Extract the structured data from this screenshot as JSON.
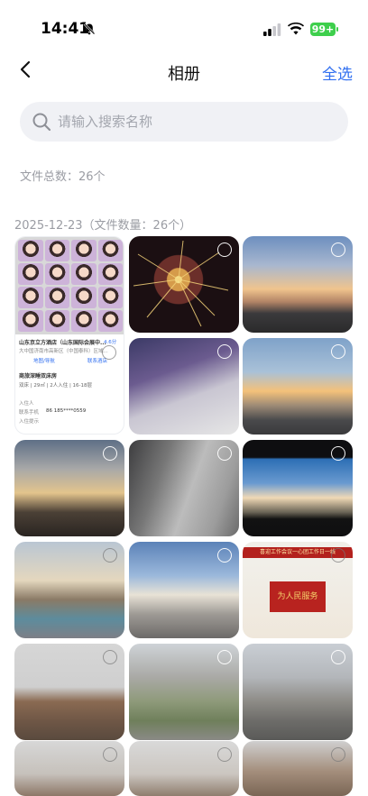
{
  "status_bar": {
    "time": "14:41",
    "battery": "99+"
  },
  "nav": {
    "title": "相册",
    "select_all": "全选"
  },
  "search": {
    "placeholder": "请输入搜索名称",
    "value": ""
  },
  "summary": {
    "total_files": "文件总数：26个"
  },
  "group": {
    "header": "2025-12-23（文件数量：26个）"
  },
  "doc_thumb": {
    "hotel_name": "山东京立方酒店（山东国际会展中...",
    "hotel_tag": "4.6分",
    "address": "大中国济南市高新区（中国泰科）区域...",
    "section_title": "商旅深睡双床房",
    "room_desc": "双床 | 29㎡ | 2人入住 | 16-18层",
    "guest_label": "入住人",
    "phone_label": "联系手机",
    "phone_value": "86 185****0559",
    "guide_label": "入住提示",
    "btn_nav": "地图/导航",
    "btn_contact": "联系酒店"
  },
  "photos": [
    {
      "name": "photo-stickers-doc"
    },
    {
      "name": "photo-fireworks"
    },
    {
      "name": "photo-sunset-hills"
    },
    {
      "name": "photo-blurred-window"
    },
    {
      "name": "photo-sunset-city"
    },
    {
      "name": "photo-dusk-silhouette"
    },
    {
      "name": "photo-station-stairs"
    },
    {
      "name": "photo-train-window"
    },
    {
      "name": "photo-street-corner"
    },
    {
      "name": "photo-buildings-sky"
    },
    {
      "name": "photo-red-banner-hall"
    },
    {
      "name": "photo-bare-tree-house"
    },
    {
      "name": "photo-courtyard-aerial"
    },
    {
      "name": "photo-street-aerial"
    },
    {
      "name": "photo-tree-1"
    },
    {
      "name": "photo-tree-2"
    },
    {
      "name": "photo-tree-3"
    }
  ],
  "banner_text": "喜迎工作会议一心团工作日一线",
  "banner_slogan": "为人民服务"
}
